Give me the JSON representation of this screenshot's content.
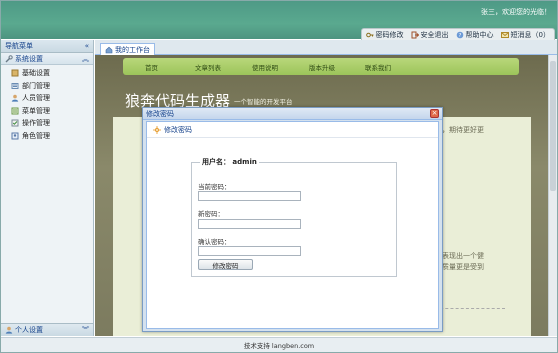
{
  "header": {
    "welcome": "张三，欢迎您的光临！",
    "toolbar": [
      {
        "label": "密码修改",
        "icon": "key-icon"
      },
      {
        "label": "安全退出",
        "icon": "exit-icon"
      },
      {
        "label": "帮助中心",
        "icon": "help-icon"
      },
      {
        "label": "短消息（0）",
        "icon": "message-icon"
      }
    ]
  },
  "leftnav": {
    "title": "导航菜单",
    "section": "系统设置",
    "items": [
      {
        "label": "基础设置",
        "icon": "settings-icon"
      },
      {
        "label": "部门管理",
        "icon": "department-icon"
      },
      {
        "label": "人员管理",
        "icon": "user-icon"
      },
      {
        "label": "菜单管理",
        "icon": "menu-icon"
      },
      {
        "label": "操作管理",
        "icon": "operation-icon"
      },
      {
        "label": "角色管理",
        "icon": "role-icon"
      }
    ],
    "bottom": "个人设置"
  },
  "main": {
    "tab": "我的工作台"
  },
  "site": {
    "nav": [
      "首页",
      "文章列表",
      "使用说明",
      "版本升级",
      "联系我们"
    ],
    "title": "狼奔代码生成器",
    "subtitle": "一个智能的开发平台",
    "text1a": "考，期待更好更",
    "text1b": "",
    "text2": "",
    "text3a": "够表现出一个健",
    "text3b": "的质量更是受到"
  },
  "modal": {
    "title": "修改密码",
    "subtitle": "修改密码",
    "legend": "用户名： admin",
    "labels": {
      "current": "当前密码：",
      "new": "新密码：",
      "confirm": "确认密码："
    },
    "button": "修改密码"
  },
  "footer": {
    "text": "技术支持 langben.com"
  },
  "colors": {
    "header": "#4e9a86",
    "nav_green": "#9cc45a",
    "accent_blue": "#15428b"
  }
}
